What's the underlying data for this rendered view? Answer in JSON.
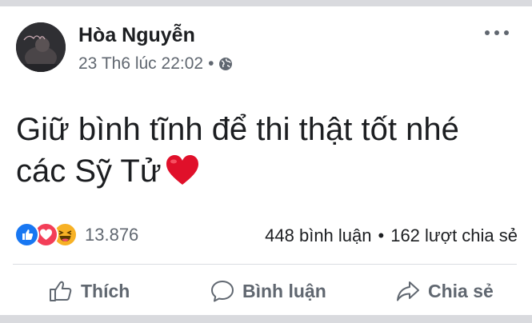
{
  "post": {
    "author": "Hòa Nguyễn",
    "date": "23 Th6 lúc 22:02",
    "separator": "•",
    "privacy_icon": "globe-icon",
    "text_line1": "Giữ bình tĩnh để thi thật tốt nhé",
    "text_line2": "các Sỹ Tử",
    "emoji": "red-heart"
  },
  "reactions": {
    "types": [
      "like",
      "love",
      "haha"
    ],
    "count": "13.876"
  },
  "stats": {
    "comments": "448 bình luận",
    "separator": "•",
    "shares": "162 lượt chia sẻ"
  },
  "actions": {
    "like_label": "Thích",
    "comment_label": "Bình luận",
    "share_label": "Chia sẻ"
  },
  "colors": {
    "like_blue": "#1877f2",
    "love_red": "#f33e58",
    "haha_yellow": "#f7b125",
    "heart_red": "#e0102a",
    "text_primary": "#1c1e21",
    "text_secondary": "#606770"
  }
}
